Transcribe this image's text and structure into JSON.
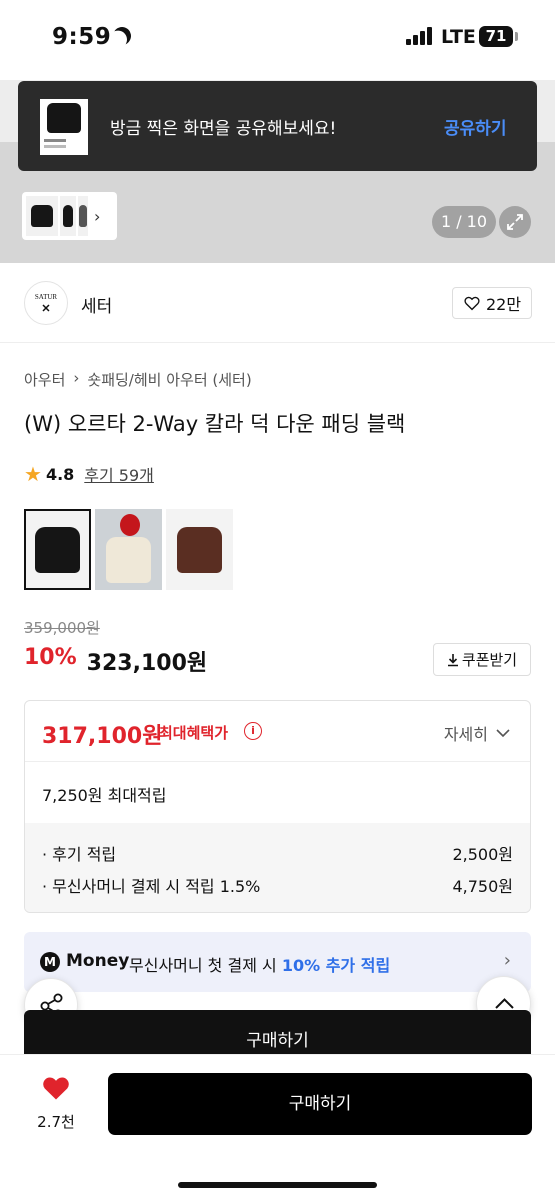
{
  "status_bar": {
    "time": "9:59",
    "network": "LTE",
    "battery": "71"
  },
  "toast": {
    "message": "방금 찍은 화면을 공유해보세요!",
    "action_label": "공유하기"
  },
  "gallery": {
    "counter": "1 / 10"
  },
  "brand": {
    "logo_text": "SATUR",
    "name": "세터",
    "like_count": "22만"
  },
  "breadcrumb": [
    "아우터",
    "숏패딩/헤비 아우터 (세터)"
  ],
  "product": {
    "title": "(W) 오르타 2-Way 칼라 덕 다운 패딩 블랙",
    "rating": "4.8",
    "review_link": "후기 59개",
    "color_options": [
      "black",
      "cream",
      "brown"
    ]
  },
  "price": {
    "original": "359,000원",
    "discount": "10%",
    "sale": "323,100원",
    "coupon_label": "쿠폰받기"
  },
  "benefit": {
    "max_price": "317,100원",
    "max_label": "최대혜택가",
    "detail_label": "자세히",
    "points_title": "7,250원 최대적립",
    "rows": [
      {
        "label": "· 후기 적립",
        "value": "2,500원"
      },
      {
        "label": "· 무신사머니 결제 시 적립 1.5%",
        "value": "4,750원"
      }
    ]
  },
  "money_banner": {
    "badge": "M",
    "brand": "Money",
    "text": "무신사머니 첫 결제 시",
    "highlight": "10% 추가 적립"
  },
  "buy_peek_label": "구매하기",
  "bottom_bar": {
    "wish_count": "2.7천",
    "buy_label": "구매하기"
  },
  "colors": {
    "accent_red": "#e0242c",
    "link_blue": "#2f6fe8",
    "toast_action": "#4a8df8"
  }
}
